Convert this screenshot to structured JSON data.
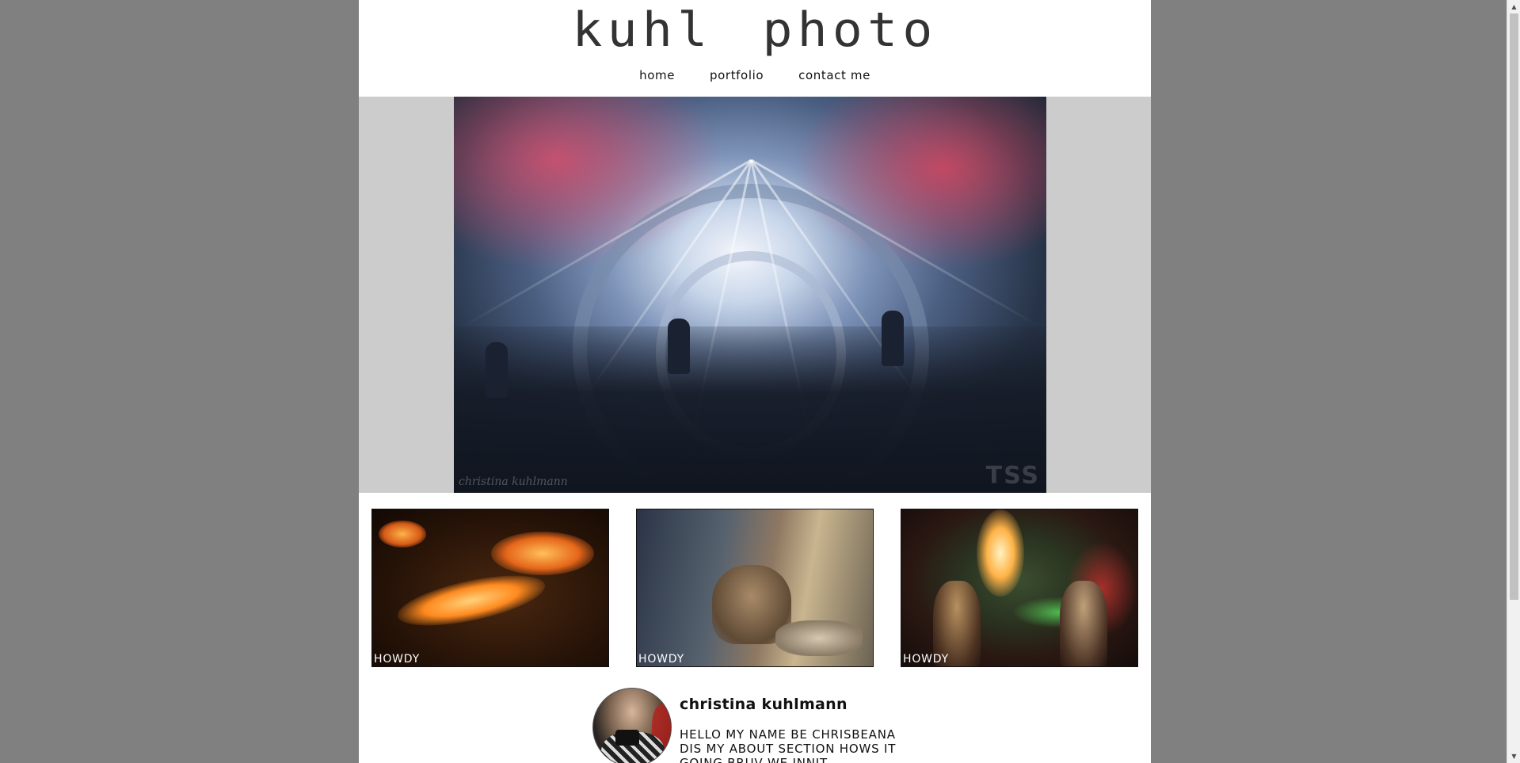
{
  "site": {
    "logo": "kuhl photo",
    "nav": [
      {
        "label": "home"
      },
      {
        "label": "portfolio"
      },
      {
        "label": "contact me"
      }
    ]
  },
  "hero": {
    "watermark_left": "christina kuhlmann",
    "watermark_right": "TSS"
  },
  "thumbnails": [
    {
      "caption": "HOWDY"
    },
    {
      "caption": "HOWDY"
    },
    {
      "caption": "HOWDY"
    }
  ],
  "about": {
    "name": "christina kuhlmann",
    "bio": "HELLO MY NAME BE CHRISBEANA DIS MY ABOUT SECTION HOWS IT GOING BRUV WE INNIT"
  },
  "colors": {
    "page_background": "#808080",
    "content_background": "#ffffff",
    "hero_background": "#cccccc"
  }
}
